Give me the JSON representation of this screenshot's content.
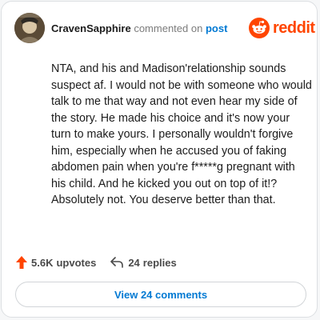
{
  "comment": {
    "username": "CravenSapphire",
    "action_text": "commented on",
    "post_link": "post",
    "body": "NTA, and his and Madison'relationship sounds suspect af. I would not be with someone who would talk to me that way and not even hear my side of the story. He made his choice and it's now your turn to make yours. I personally wouldn't forgive him, especially when he accused you of faking abdomen pain when you're f*****g pregnant with his child. And he kicked you out on top of it!? Absolutely not. You deserve better than that."
  },
  "brand": {
    "wordmark": "reddit",
    "color": "#ff4500"
  },
  "actions": {
    "upvote_count": "5.6K",
    "upvotes_label": "upvotes",
    "reply_count": "24",
    "replies_label": "replies"
  },
  "footer": {
    "view_comments_label": "View 24 comments"
  },
  "icons": {
    "avatar": "avatar",
    "brand_logo": "reddit-snoo-icon",
    "upvote": "upvote-arrow-icon",
    "reply": "reply-arrow-icon"
  },
  "colors": {
    "accent": "#ff4500",
    "link": "#0079d3",
    "text": "#1c1c1c",
    "muted": "#7c7c7c"
  }
}
